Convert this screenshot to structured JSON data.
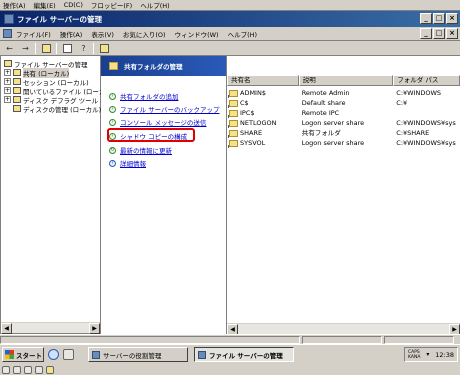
{
  "outer_menu": [
    "操作(A)",
    "編集(E)",
    "CD(C)",
    "フロッピー(F)",
    "ヘルプ(H)"
  ],
  "window": {
    "title": "ファイル サーバーの管理",
    "buttons": {
      "minimize": "_",
      "maximize": "□",
      "close": "×"
    }
  },
  "menubar": [
    "ファイル(F)",
    "操作(A)",
    "表示(V)",
    "お気に入り(O)",
    "ウィンドウ(W)",
    "ヘルプ(H)"
  ],
  "toolbar_icons": [
    "back-arrow",
    "forward-arrow",
    "up-folder",
    "properties",
    "help",
    "shared-folders"
  ],
  "tree": {
    "root": "ファイル サーバーの管理",
    "items": [
      "共有 (ローカル)",
      "セッション (ローカル)",
      "開いているファイル (ローカル",
      "ディスク デフラグ ツール",
      "ディスクの管理 (ローカル)"
    ]
  },
  "taskpad": {
    "header": "共有フォルダの管理",
    "tasks": [
      "共有フォルダの追加",
      "ファイル サーバーのバックアップ",
      "コンソール メッセージの送信",
      "シャドウ コピーの構成",
      "最新の情報に更新",
      "詳細情報"
    ]
  },
  "list": {
    "columns": [
      "共有名",
      "説明",
      "フォルダ パス"
    ],
    "rows": [
      {
        "name": "ADMIN$",
        "desc": "Remote Admin",
        "path": "C:¥WINDOWS"
      },
      {
        "name": "C$",
        "desc": "Default share",
        "path": "C:¥"
      },
      {
        "name": "IPC$",
        "desc": "Remote IPC",
        "path": ""
      },
      {
        "name": "NETLOGON",
        "desc": "Logon server share",
        "path": "C:¥WINDOWS¥sys"
      },
      {
        "name": "SHARE",
        "desc": "共有フォルダ",
        "path": "C:¥SHARE"
      },
      {
        "name": "SYSVOL",
        "desc": "Logon server share",
        "path": "C:¥WINDOWS¥sys"
      }
    ]
  },
  "taskbar": {
    "start": "スタート",
    "buttons": [
      "サーバーの役割管理",
      "ファイル サーバーの管理"
    ],
    "ime": [
      "CAPS",
      "KANA"
    ],
    "clock": "12:38"
  },
  "colors": {
    "highlight": "#e00000",
    "title_bar": "#0a246a",
    "taskpad_header": "#1a3f8f",
    "link": "#0000cc"
  }
}
